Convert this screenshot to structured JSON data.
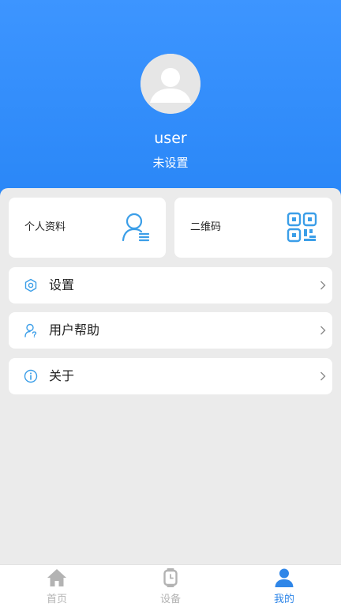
{
  "header": {
    "username": "user",
    "status": "未设置"
  },
  "cards": {
    "profile": {
      "label": "个人资料",
      "icon": "user-list-icon"
    },
    "qrcode": {
      "label": "二维码",
      "icon": "qr-code-icon"
    }
  },
  "menu": {
    "settings": {
      "label": "设置",
      "icon": "gear-icon"
    },
    "help": {
      "label": "用户帮助",
      "icon": "user-help-icon"
    },
    "about": {
      "label": "关于",
      "icon": "info-icon"
    }
  },
  "tabbar": {
    "home": {
      "label": "首页",
      "icon": "home-icon",
      "active": false
    },
    "device": {
      "label": "设备",
      "icon": "watch-icon",
      "active": false
    },
    "mine": {
      "label": "我的",
      "icon": "person-icon",
      "active": true
    }
  },
  "colors": {
    "header_top": "#3d95ff",
    "header_bottom": "#2a87f7",
    "accent": "#2f86e8",
    "icon_blue": "#3b9ee8",
    "inactive": "#b3b3b3",
    "background": "#ebebeb"
  }
}
